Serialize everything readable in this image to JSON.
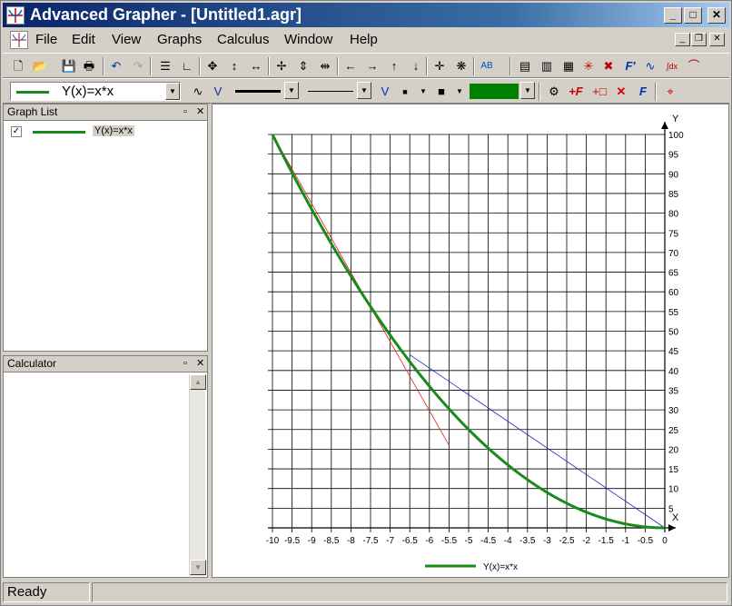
{
  "window": {
    "title": "Advanced Grapher - [Untitled1.agr]"
  },
  "menu": [
    "File",
    "Edit",
    "View",
    "Graphs",
    "Calculus",
    "Window",
    "Help"
  ],
  "toolbar2": {
    "function_combo": "Y(x)=x*x",
    "color_accent": "#008000"
  },
  "graph_list": {
    "title": "Graph List",
    "items": [
      {
        "label": "Y(x)=x*x",
        "checked": true,
        "color": "#1a8a1a"
      }
    ]
  },
  "calculator": {
    "title": "Calculator"
  },
  "status": {
    "text": "Ready"
  },
  "chart_data": {
    "type": "line",
    "function": "Y(x)=x*x",
    "xlim": [
      -10,
      0
    ],
    "ylim": [
      0,
      100
    ],
    "x_ticks": [
      "-10",
      "-9.5",
      "-9",
      "-8.5",
      "-8",
      "-7.5",
      "-7",
      "-6.5",
      "-6",
      "-5.5",
      "-5",
      "-4.5",
      "-4",
      "-3.5",
      "-3",
      "-2.5",
      "-2",
      "-1.5",
      "-1",
      "-0.5",
      "0"
    ],
    "y_ticks": [
      "5",
      "10",
      "15",
      "20",
      "25",
      "30",
      "35",
      "40",
      "45",
      "50",
      "55",
      "60",
      "65",
      "70",
      "75",
      "80",
      "85",
      "90",
      "95",
      "100"
    ],
    "xlabel": "X",
    "ylabel": "Y",
    "legend": "Y(x)=x*x",
    "series": [
      {
        "name": "Y(x)=x*x",
        "color": "#1a8a1a",
        "expr": "x*x",
        "x_range": [
          -10,
          0
        ]
      }
    ],
    "tangent_line": {
      "color": "#e02020",
      "points": [
        [
          -10,
          100
        ],
        [
          -5.5,
          21
        ]
      ]
    },
    "secant_line": {
      "color": "#2020c0",
      "points": [
        [
          -6.5,
          44
        ],
        [
          0,
          0
        ]
      ]
    },
    "grid": true
  }
}
